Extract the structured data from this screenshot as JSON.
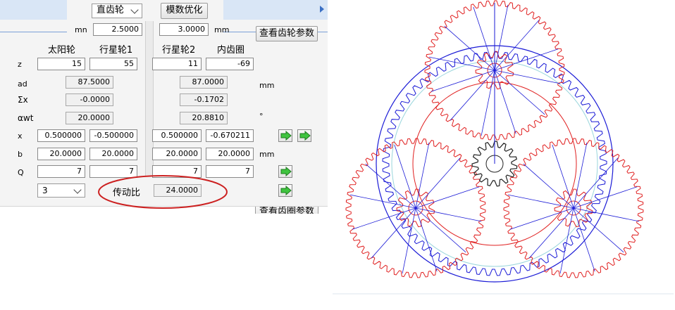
{
  "toolbar": {
    "gear_type": "直齿轮",
    "optimize_label": "模数优化",
    "view_params_label": "查看齿轮参数",
    "view_params_label_partial": "查看齿圈参数"
  },
  "module": {
    "label": "mn",
    "value1": "2.5000",
    "value2": "3.0000",
    "unit": "mm"
  },
  "columns": {
    "sun": "太阳轮",
    "planet1": "行星轮1",
    "planet2": "行星轮2",
    "ring": "内齿圈"
  },
  "rows": {
    "z": {
      "label": "z",
      "sun": "15",
      "planet1": "55",
      "planet2": "11",
      "ring": "-69"
    },
    "ad": {
      "label": "ad",
      "v1": "87.5000",
      "v2": "87.0000",
      "unit": "mm"
    },
    "sx": {
      "label": "Σx",
      "v1": "-0.0000",
      "v2": "-0.1702"
    },
    "awt": {
      "label": "αwt",
      "v1": "20.0000",
      "v2": "20.8810",
      "unit": "°"
    },
    "x": {
      "label": "x",
      "sun": "0.500000",
      "planet1": "-0.500000",
      "planet2": "0.500000",
      "ring": "-0.670211"
    },
    "b": {
      "label": "b",
      "sun": "20.0000",
      "planet1": "20.0000",
      "planet2": "20.0000",
      "ring": "20.0000",
      "unit": "mm"
    },
    "Q": {
      "label": "Q",
      "sun": "7",
      "planet1": "7",
      "planet2": "7",
      "ring": "7"
    }
  },
  "planets_count": "3",
  "ratio": {
    "label": "传动比",
    "value": "24.0000"
  },
  "colors": {
    "gear_red": "#e02020",
    "gear_blue": "#1a1ad6",
    "gear_black": "#222222",
    "pitch_cyan": "#9ad6dc",
    "highlight": "#cc2020"
  },
  "icons": [
    "chevron-down-icon",
    "green-arrow-right-icon",
    "chevron-right-icon"
  ]
}
